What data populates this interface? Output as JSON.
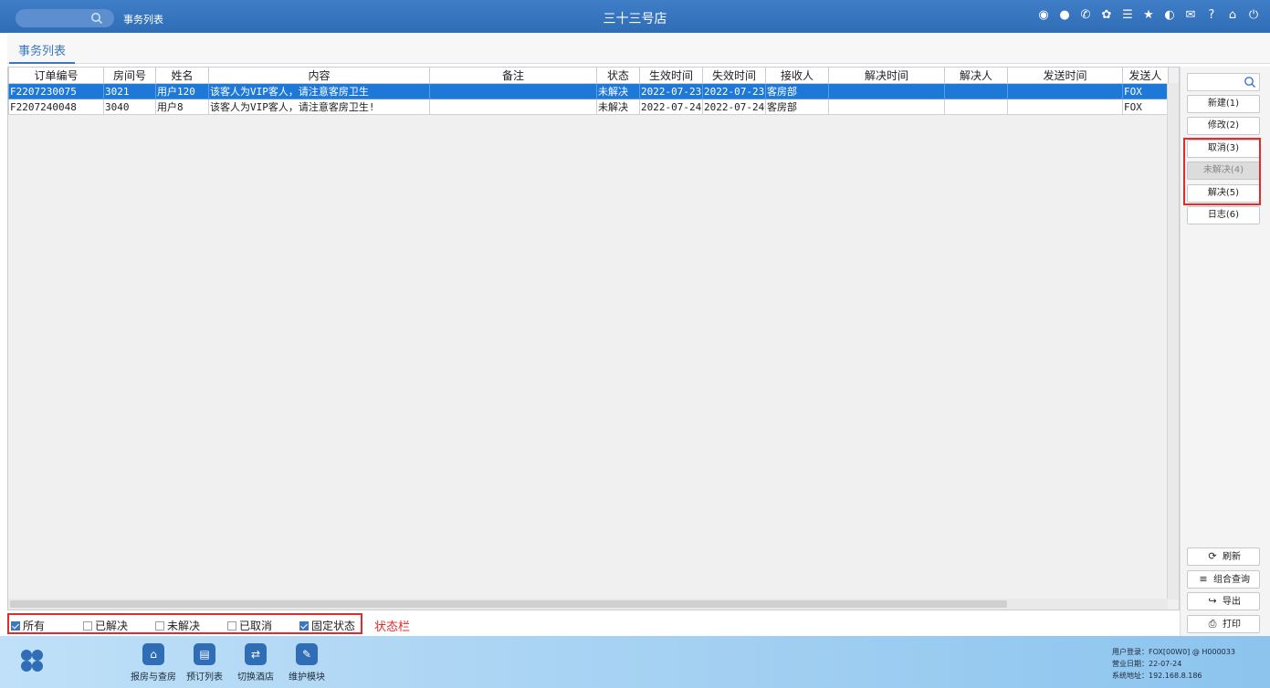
{
  "topbar": {
    "breadcrumb": "事务列表",
    "store_title": "三十三号店",
    "icons": [
      "wifi-icon",
      "chat-icon",
      "phone-icon",
      "palette-icon",
      "menu-icon",
      "star-icon",
      "contrast-icon",
      "mail-icon",
      "help-icon",
      "home-icon",
      "power-icon"
    ]
  },
  "tabs": [
    {
      "label": "事务列表"
    }
  ],
  "table": {
    "headers": [
      "订单编号",
      "房间号",
      "姓名",
      "内容",
      "备注",
      "状态",
      "生效时间",
      "失效时间",
      "接收人",
      "解决时间",
      "解决人",
      "发送时间",
      "发送人"
    ],
    "rows": [
      [
        "F2207230075",
        "3021",
        "用户120",
        "该客人为VIP客人，请注意客房卫生",
        "",
        "未解决",
        "2022-07-23",
        "2022-07-23",
        "客房部",
        "",
        "",
        "",
        "FOX"
      ],
      [
        "F2207240048",
        "3040",
        "用户8",
        "该客人为VIP客人，请注意客房卫生!",
        "",
        "未解决",
        "2022-07-24",
        "2022-07-24",
        "客房部",
        "",
        "",
        "",
        "FOX"
      ]
    ],
    "selected_row": 0
  },
  "side_buttons": {
    "new": "新建(1)",
    "edit": "修改(2)",
    "cancel": "取消(3)",
    "unresolve": "未解决(4)",
    "resolve": "解决(5)",
    "log": "日志(6)",
    "refresh": "刷新",
    "combined_query": "组合查询",
    "export": "导出",
    "print": "打印"
  },
  "status_filters": [
    {
      "label": "所有",
      "checked": true
    },
    {
      "label": "已解决",
      "checked": false
    },
    {
      "label": "未解决",
      "checked": false
    },
    {
      "label": "已取消",
      "checked": false
    },
    {
      "label": "固定状态",
      "checked": true
    }
  ],
  "status_annotation": "状态栏",
  "footer": {
    "buttons": [
      "报房与查房",
      "预订列表",
      "切换酒店",
      "维护模块"
    ],
    "sysinfo": {
      "user_line": "用户登录：FOX[00W0] @ H000033",
      "date_line": "营业日期：22-07-24",
      "addr_line": "系统地址：192.168.8.186"
    }
  },
  "colors": {
    "accent": "#2f6db7",
    "selected_row": "#1e78d7",
    "annotation_red": "#e22b2b"
  }
}
